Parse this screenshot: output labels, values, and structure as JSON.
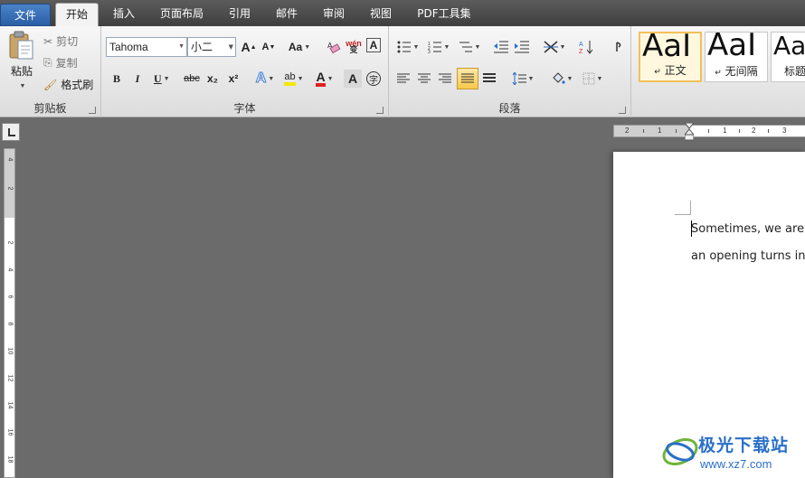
{
  "menu": {
    "tabs": [
      "文件",
      "开始",
      "插入",
      "页面布局",
      "引用",
      "邮件",
      "审阅",
      "视图",
      "PDF工具集"
    ],
    "active": "开始"
  },
  "clipboard": {
    "paste_label": "粘贴",
    "cut_label": "剪切",
    "copy_label": "复制",
    "format_painter_label": "格式刷",
    "group_label": "剪贴板"
  },
  "font": {
    "name": "Tahoma",
    "size": "小二",
    "group_label": "字体",
    "grow_label": "A",
    "shrink_label": "A",
    "case_label": "Aa",
    "phonetic_label": "wén",
    "bold": "B",
    "italic": "I",
    "underline": "U",
    "strike": "abc",
    "subscript": "x₂",
    "superscript": "x²",
    "color": "#e02020",
    "highlight": "#f5e800"
  },
  "paragraph": {
    "group_label": "段落"
  },
  "styles": [
    {
      "preview": "AaI",
      "name": "正文"
    },
    {
      "preview": "AaI",
      "name": "无间隔"
    },
    {
      "preview": "Aa",
      "name": "标题"
    }
  ],
  "ruler": {
    "h_numbers": [
      "2",
      "1",
      "1",
      "2",
      "3"
    ],
    "v_numbers": [
      "4",
      "2",
      "2",
      "4",
      "6",
      "8",
      "10",
      "12",
      "14",
      "16",
      "18",
      "20"
    ]
  },
  "document": {
    "line1": "Sometimes, we are li",
    "line2": "an opening turns int"
  },
  "watermark": {
    "text": "极光下载站",
    "url": "www.xz7.com"
  }
}
